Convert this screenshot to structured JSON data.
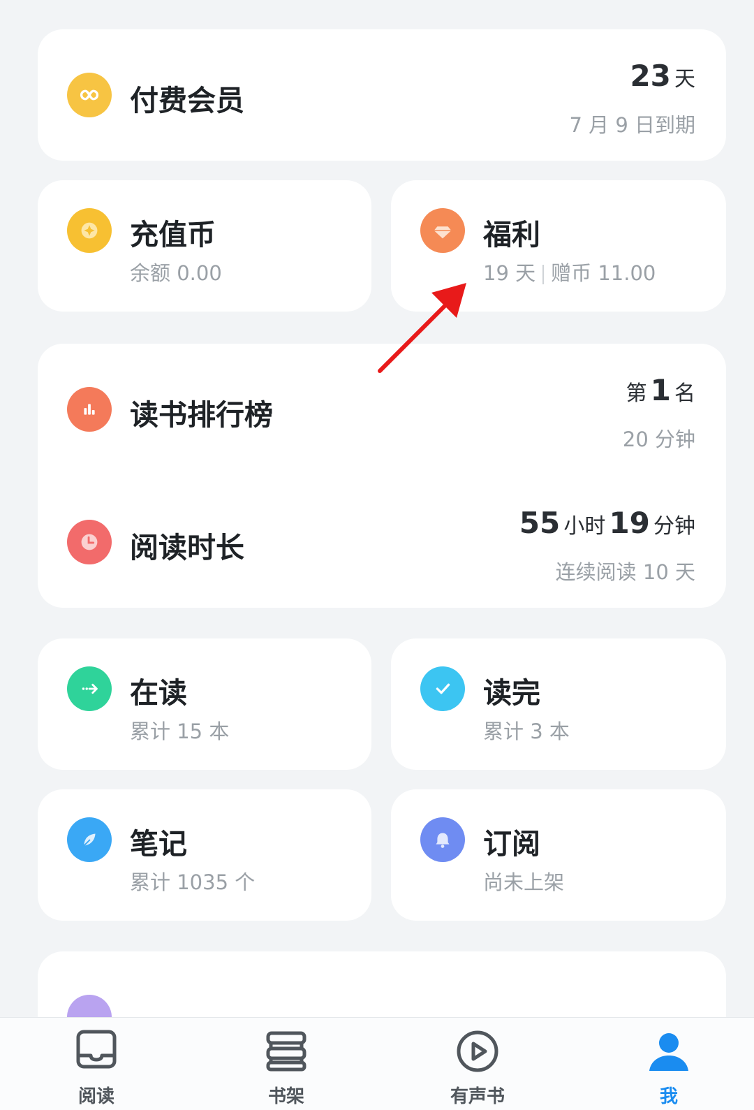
{
  "cards": {
    "membership": {
      "title": "付费会员",
      "days_value": "23",
      "days_unit": "天",
      "expiry": "7 月 9 日到期",
      "icon": "infinity-icon",
      "icon_color": "#f7c443"
    },
    "coins": {
      "title": "充值币",
      "subtitle": "余额 0.00",
      "icon": "coin-icon",
      "icon_color": "#f7c032"
    },
    "welfare": {
      "title": "福利",
      "subtitle_days": "19 天",
      "subtitle_coins": "赠币 11.00",
      "icon": "diamond-icon",
      "icon_color": "#f58a55"
    },
    "ranking": {
      "title": "读书排行榜",
      "rank_prefix": "第",
      "rank_value": "1",
      "rank_suffix": "名",
      "minutes": "20 分钟",
      "icon": "bar-chart-icon",
      "icon_color": "#f47a5a"
    },
    "reading_time": {
      "title": "阅读时长",
      "hours_value": "55",
      "hours_unit": "小时",
      "minutes_value": "19",
      "minutes_unit": "分钟",
      "streak": "连续阅读 10 天",
      "icon": "clock-icon",
      "icon_color": "#f26b6b"
    },
    "reading": {
      "title": "在读",
      "subtitle": "累计 15 本",
      "icon": "arrow-right-icon",
      "icon_color": "#2fd39a"
    },
    "finished": {
      "title": "读完",
      "subtitle": "累计 3 本",
      "icon": "check-icon",
      "icon_color": "#3cc5f2"
    },
    "notes": {
      "title": "笔记",
      "subtitle": "累计 1035 个",
      "icon": "feather-icon",
      "icon_color": "#3aa8f5"
    },
    "subscribe": {
      "title": "订阅",
      "subtitle": "尚未上架",
      "icon": "bell-icon",
      "icon_color": "#6f8cf2"
    }
  },
  "tabbar": {
    "items": [
      {
        "label": "阅读",
        "icon": "book-icon"
      },
      {
        "label": "书架",
        "icon": "bookshelf-icon"
      },
      {
        "label": "有声书",
        "icon": "play-icon"
      },
      {
        "label": "我",
        "icon": "person-icon",
        "active": true
      }
    ]
  },
  "colors": {
    "accent": "#1a8cf0",
    "annotation_arrow": "#e81a1a"
  }
}
